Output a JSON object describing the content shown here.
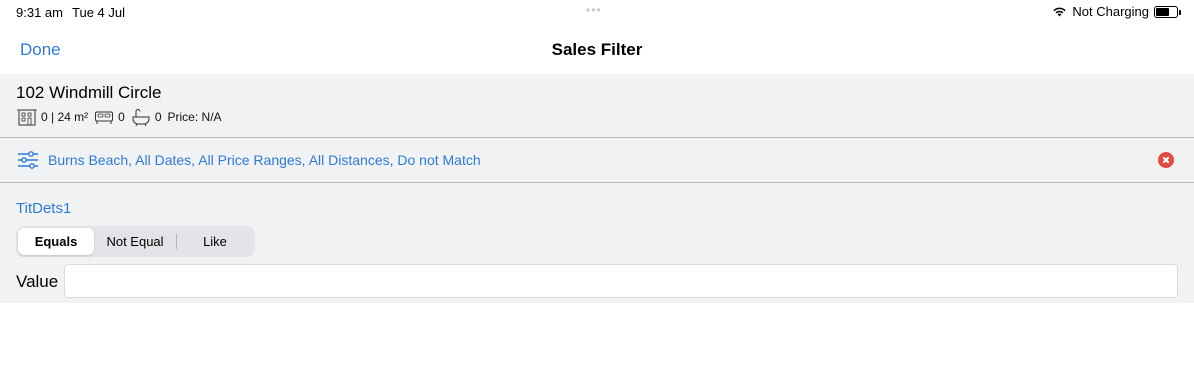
{
  "status": {
    "time": "9:31 am",
    "date": "Tue 4 Jul",
    "battery_text": "Not Charging",
    "battery_level": 0.65
  },
  "nav": {
    "done_label": "Done",
    "title": "Sales Filter"
  },
  "property": {
    "name": "102 Windmill Circle",
    "area": "0 | 24 m²",
    "bedrooms": "0",
    "bathrooms": "0",
    "price": "Price: N/A"
  },
  "filter": {
    "summary": "Burns Beach, All Dates, All Price Ranges, All Distances, Do not Match"
  },
  "form": {
    "field_title": "TitDets1",
    "segments": [
      "Equals",
      "Not Equal",
      "Like"
    ],
    "selected_segment": "Equals",
    "value_label": "Value",
    "value": "",
    "value_placeholder": ""
  },
  "colors": {
    "accent": "#2f7ad6",
    "clear_button": "#e24a3f",
    "panel_background": "#f1f2f4"
  }
}
